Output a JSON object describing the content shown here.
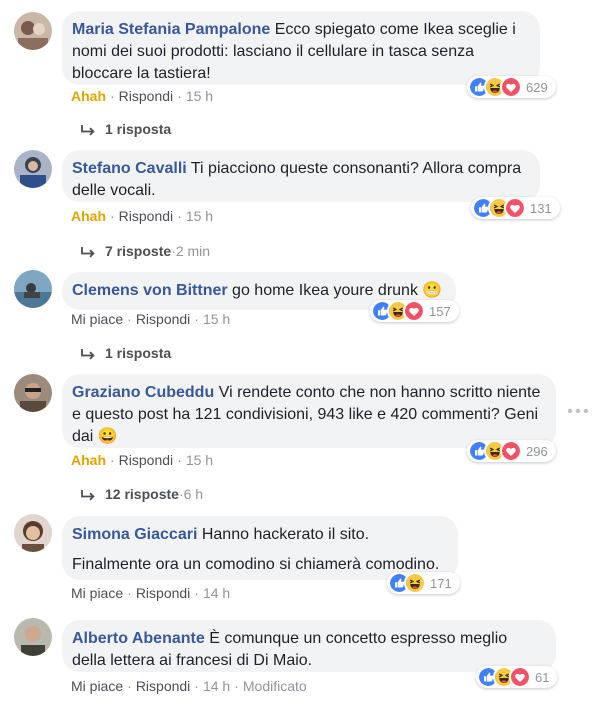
{
  "colors": {
    "author": "#385898",
    "bubble": "#f2f3f5",
    "meta": "#90949c",
    "action": "#4b4f56",
    "ahah": "#e0a400",
    "like_blue": "#4080ff",
    "laugh_yellow": "#f7c947",
    "love_red": "#f25268"
  },
  "comments": [
    {
      "author": "Maria Stefania Pampalone",
      "text": "Ecco spiegato come Ikea sceglie i nomi dei suoi prodotti: lasciano il cellulare in tasca senza bloccare la tastiera!",
      "reaction_label": "Ahah",
      "reply_label": "Rispondi",
      "time": "15 h",
      "reactions": [
        "like",
        "haha",
        "love"
      ],
      "reaction_count": "629",
      "replies": "1 risposta",
      "replies_time": ""
    },
    {
      "author": "Stefano Cavalli",
      "text": "Ti piacciono queste consonanti? Allora compra delle vocali.",
      "reaction_label": "Ahah",
      "reply_label": "Rispondi",
      "time": "15 h",
      "reactions": [
        "like",
        "haha",
        "love"
      ],
      "reaction_count": "131",
      "replies": "7 risposte",
      "replies_time": "2 min"
    },
    {
      "author": "Clemens von Bittner",
      "text": "go home Ikea youre drunk 😬",
      "reaction_label": "Mi piace",
      "reply_label": "Rispondi",
      "time": "15 h",
      "reactions": [
        "like",
        "haha",
        "love"
      ],
      "reaction_count": "157",
      "replies": "1 risposta",
      "replies_time": ""
    },
    {
      "author": "Graziano Cubeddu",
      "text": "Vi rendete conto che non hanno scritto niente e questo post ha 121 condivisioni, 943 like e 420 commenti? Geni dai 😀",
      "reaction_label": "Ahah",
      "reply_label": "Rispondi",
      "time": "15 h",
      "reactions": [
        "like",
        "haha",
        "love"
      ],
      "reaction_count": "296",
      "replies": "12 risposte",
      "replies_time": "6 h"
    },
    {
      "author": "Simona Giaccari",
      "text": "Hanno hackerato il sito.",
      "text2": "Finalmente ora un comodino si chiamerà comodino.",
      "reaction_label": "Mi piace",
      "reply_label": "Rispondi",
      "time": "14 h",
      "reactions": [
        "like",
        "haha"
      ],
      "reaction_count": "171"
    },
    {
      "author": "Alberto Abenante",
      "text": "È comunque un concetto espresso meglio della lettera ai francesi di Di Maio.",
      "reaction_label": "Mi piace",
      "reply_label": "Rispondi",
      "time": "14 h",
      "edited": "Modificato",
      "reactions": [
        "like",
        "haha",
        "love"
      ],
      "reaction_count": "61"
    }
  ]
}
